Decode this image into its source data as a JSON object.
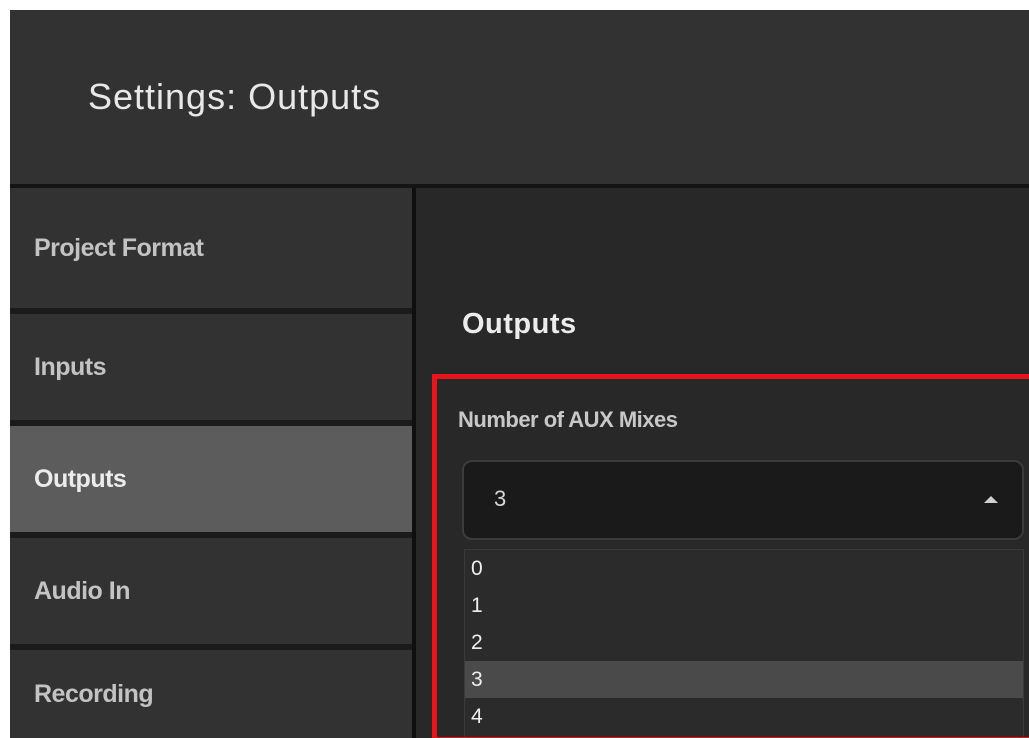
{
  "header": {
    "title": "Settings: Outputs"
  },
  "sidebar": {
    "items": [
      {
        "label": "Project Format"
      },
      {
        "label": "Inputs"
      },
      {
        "label": "Outputs",
        "active": true
      },
      {
        "label": "Audio In"
      },
      {
        "label": "Recording"
      }
    ]
  },
  "main": {
    "section_title": "Outputs",
    "aux_mixes": {
      "label": "Number of AUX Mixes",
      "selected_value": "3",
      "caret_icon": "caret-up-icon",
      "options": [
        "0",
        "1",
        "2",
        "3",
        "4"
      ]
    }
  },
  "colors": {
    "highlight_border": "#e8141a",
    "active_nav_bg": "#5c5c5c",
    "nav_bg": "#323232",
    "header_bg": "#323232"
  }
}
